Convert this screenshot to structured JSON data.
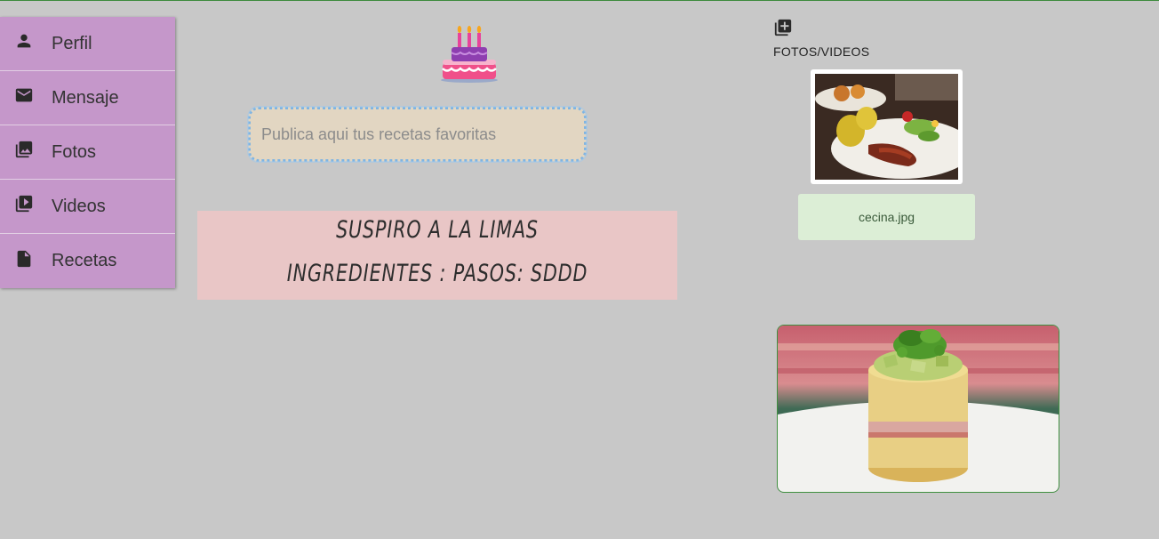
{
  "sidebar": {
    "items": [
      {
        "label": "Perfil",
        "icon": "person-icon"
      },
      {
        "label": "Mensaje",
        "icon": "mail-icon"
      },
      {
        "label": "Fotos",
        "icon": "photo-library-icon"
      },
      {
        "label": "Videos",
        "icon": "video-library-icon"
      },
      {
        "label": "Recetas",
        "icon": "document-icon"
      }
    ]
  },
  "composer": {
    "placeholder": "Publica aqui tus recetas favoritas"
  },
  "recipe": {
    "title": "SUSPIRO A LA LIMAS",
    "details": "INGREDIENTES : PASOS: SDDD"
  },
  "media": {
    "label": "FOTOS/VIDEOS",
    "file_name": "cecina.jpg"
  },
  "colors": {
    "background": "#c8c8c8",
    "sidebar": "#c597ca",
    "recipe_card": "#e9c6c6",
    "file_badge": "#dceed6",
    "input_bg": "#e2d6c2"
  }
}
